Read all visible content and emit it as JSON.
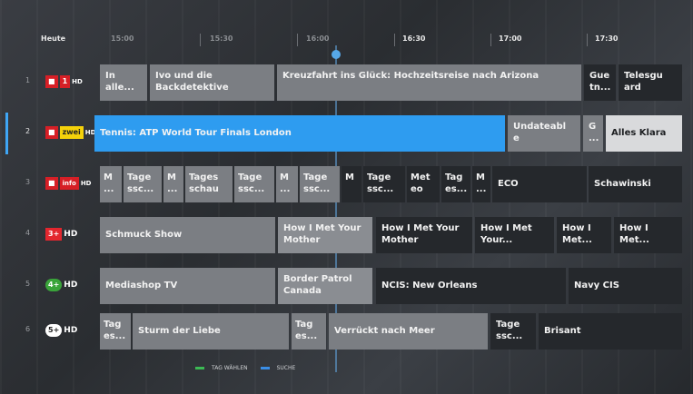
{
  "timeline": {
    "day": "Heute",
    "times": [
      "15:00",
      "15:30",
      "16:00",
      "16:30",
      "17:00",
      "17:30"
    ]
  },
  "channels": [
    {
      "num": "1",
      "logo": "SRF 1 HD",
      "programs": [
        {
          "title": "In alle...",
          "style": "grey"
        },
        {
          "title": "Ivo und die Backdetektive",
          "style": "grey"
        },
        {
          "title": "Kreuzfahrt ins Glück: Hochzeitsreise nach Arizona",
          "style": "grey"
        },
        {
          "title": "Gue tn...",
          "style": "dark"
        },
        {
          "title": "Telesgu ard",
          "style": "dark"
        }
      ]
    },
    {
      "num": "2",
      "logo": "SRF zwei HD",
      "programs": [
        {
          "title": "Tennis: ATP World Tour Finals London",
          "style": "blue"
        },
        {
          "title": "Undateabl e",
          "style": "grey"
        },
        {
          "title": "G ...",
          "style": "grey"
        },
        {
          "title": "Alles Klara",
          "style": "white"
        }
      ]
    },
    {
      "num": "3",
      "logo": "SRF info HD",
      "programs": [
        {
          "title": "M ...",
          "style": "grey"
        },
        {
          "title": "Tage ssc...",
          "style": "grey"
        },
        {
          "title": "M ...",
          "style": "grey"
        },
        {
          "title": "Tages schau",
          "style": "grey"
        },
        {
          "title": "Tage ssc...",
          "style": "grey"
        },
        {
          "title": "M ...",
          "style": "grey"
        },
        {
          "title": "Tage ssc...",
          "style": "grey"
        },
        {
          "title": "M",
          "style": "dark"
        },
        {
          "title": "Tage ssc...",
          "style": "dark"
        },
        {
          "title": "Met eo",
          "style": "dark"
        },
        {
          "title": "Tag es...",
          "style": "dark"
        },
        {
          "title": "M ...",
          "style": "dark"
        },
        {
          "title": "ECO",
          "style": "dark"
        },
        {
          "title": "Schawinski",
          "style": "dark"
        }
      ]
    },
    {
      "num": "4",
      "logo": "3+ HD",
      "programs": [
        {
          "title": "Schmuck Show",
          "style": "grey"
        },
        {
          "title": "How I Met Your Mother",
          "style": "light"
        },
        {
          "title": "How I Met Your Mother",
          "style": "dark"
        },
        {
          "title": "How I Met Your...",
          "style": "dark"
        },
        {
          "title": "How I Met...",
          "style": "dark"
        },
        {
          "title": "How I Met...",
          "style": "dark"
        }
      ]
    },
    {
      "num": "5",
      "logo": "4+ HD",
      "programs": [
        {
          "title": "Mediashop TV",
          "style": "grey"
        },
        {
          "title": "Border Patrol Canada",
          "style": "light"
        },
        {
          "title": "NCIS: New Orleans",
          "style": "dark"
        },
        {
          "title": "Navy CIS",
          "style": "dark"
        }
      ]
    },
    {
      "num": "6",
      "logo": "5+ HD",
      "programs": [
        {
          "title": "Tag es...",
          "style": "grey"
        },
        {
          "title": "Sturm der Liebe",
          "style": "grey"
        },
        {
          "title": "Tag es...",
          "style": "grey"
        },
        {
          "title": "Verrückt nach Meer",
          "style": "grey"
        },
        {
          "title": "Tage ssc...",
          "style": "dark"
        },
        {
          "title": "Brisant",
          "style": "dark"
        }
      ]
    }
  ],
  "footer": {
    "green_label": "TAG WÄHLEN",
    "blue_label": "SUCHE"
  }
}
